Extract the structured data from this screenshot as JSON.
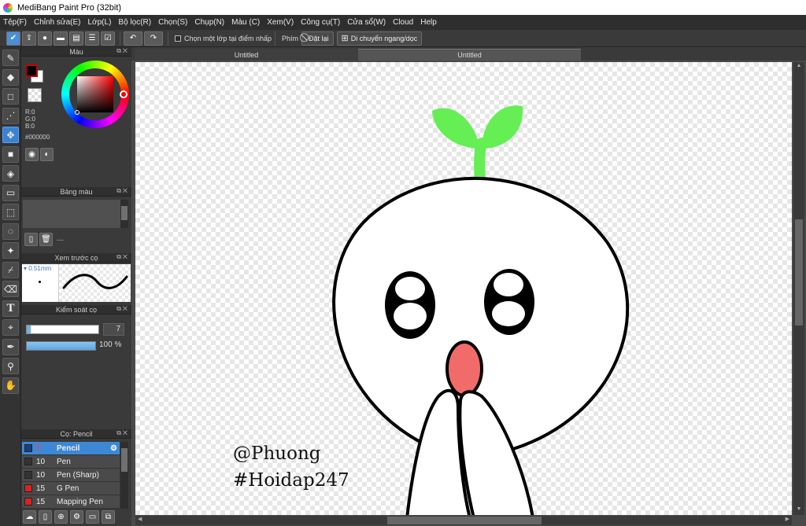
{
  "window": {
    "title": "MediBang Paint Pro (32bit)"
  },
  "menu": [
    "Tệp(F)",
    "Chỉnh sửa(E)",
    "Lớp(L)",
    "Bộ lọc(R)",
    "Chọn(S)",
    "Chụp(N)",
    "Màu (C)",
    "Xem(V)",
    "Công cụ(T)",
    "Cửa sổ(W)",
    "Cloud",
    "Help"
  ],
  "toolbar": {
    "select_layer_label": "Chọn một lớp tại điểm nhấp",
    "key_label": "Phím",
    "reset_label": "Đặt lại",
    "flip_label": "Di chuyển ngang/dọc"
  },
  "color_panel": {
    "title": "Màu",
    "r": "R:0",
    "g": "G:0",
    "b": "B:0",
    "hex": "#000000",
    "fg_color": "#000000",
    "bg_color": "#ffffff"
  },
  "palette_panel": {
    "title": "Bảng màu",
    "empty_label": "---"
  },
  "preview_panel": {
    "title": "Xem trước cọ",
    "size": "0.51mm"
  },
  "brush_control": {
    "title": "Kiểm soát cọ",
    "size_value": "7",
    "opacity_value": "100 %",
    "size_fraction": 0.06,
    "opacity_fraction": 1.0
  },
  "brush_list": {
    "title": "Cọ: Pencil",
    "items": [
      {
        "size": "7",
        "name": "Pencil",
        "color": "blue",
        "selected": true
      },
      {
        "size": "10",
        "name": "Pen",
        "color": "dark",
        "selected": false
      },
      {
        "size": "10",
        "name": "Pen (Sharp)",
        "color": "dark",
        "selected": false
      },
      {
        "size": "15",
        "name": "G Pen",
        "color": "red",
        "selected": false
      },
      {
        "size": "15",
        "name": "Mapping Pen",
        "color": "red",
        "selected": false
      }
    ]
  },
  "tabs": [
    {
      "label": "Untitled"
    },
    {
      "label": "Untitled"
    }
  ],
  "canvas": {
    "watermark_line1": "@Phuong",
    "watermark_line2": "#Hoidap247",
    "sprout_color": "#66ee55",
    "nose_color": "#f26b6b"
  }
}
